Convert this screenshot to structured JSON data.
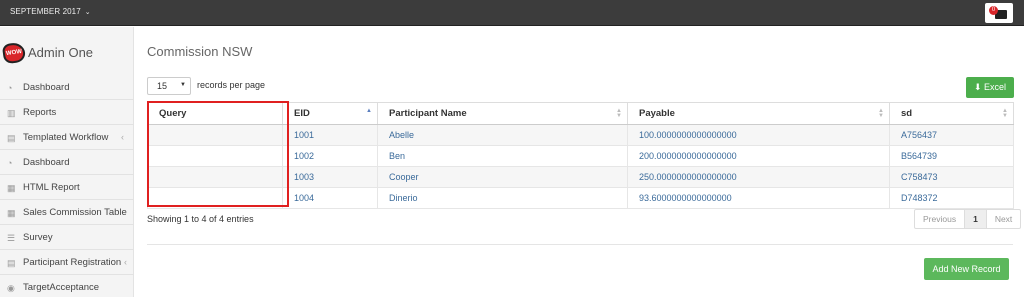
{
  "topbar": {
    "period": "SEPTEMBER 2017",
    "notification_count": "0"
  },
  "brand": {
    "logo_text": "WOW",
    "name": "Admin One"
  },
  "sidebar": {
    "items": [
      {
        "label": "Dashboard",
        "icon": "dashboard-icon"
      },
      {
        "label": "Reports",
        "icon": "bar-chart-icon"
      },
      {
        "label": "Templated Workflow",
        "icon": "file-icon",
        "caret": "‹"
      },
      {
        "label": "Dashboard",
        "icon": "dashboard-icon"
      },
      {
        "label": "HTML Report",
        "icon": "grid-icon"
      },
      {
        "label": "Sales Commission Table",
        "icon": "grid-icon"
      },
      {
        "label": "Survey",
        "icon": "list-icon"
      },
      {
        "label": "Participant Registration",
        "icon": "file-icon",
        "caret": "‹"
      },
      {
        "label": "TargetAcceptance",
        "icon": "circle-icon"
      }
    ]
  },
  "main": {
    "title": "Commission NSW",
    "page_length": "15",
    "records_text": "records per page",
    "excel_label": "Excel",
    "columns": [
      "Query",
      "EID",
      "Participant Name",
      "Payable",
      "sd"
    ],
    "rows": [
      {
        "query": "",
        "eid": "1001",
        "name": "Abelle",
        "payable": "100.0000000000000000",
        "sd": "A756437"
      },
      {
        "query": "",
        "eid": "1002",
        "name": "Ben",
        "payable": "200.0000000000000000",
        "sd": "B564739"
      },
      {
        "query": "",
        "eid": "1003",
        "name": "Cooper",
        "payable": "250.0000000000000000",
        "sd": "C758473"
      },
      {
        "query": "",
        "eid": "1004",
        "name": "Dinerio",
        "payable": "93.6000000000000000",
        "sd": "D748372"
      }
    ],
    "info": "Showing 1 to 4 of 4 entries",
    "pager": {
      "previous": "Previous",
      "current": "1",
      "next": "Next"
    },
    "add_label": "Add New Record"
  },
  "colors": {
    "topbar": "#3c3c3c",
    "button_green": "#5cb85c",
    "highlight_red": "#e02020",
    "link_blue": "#3a6a9a"
  }
}
